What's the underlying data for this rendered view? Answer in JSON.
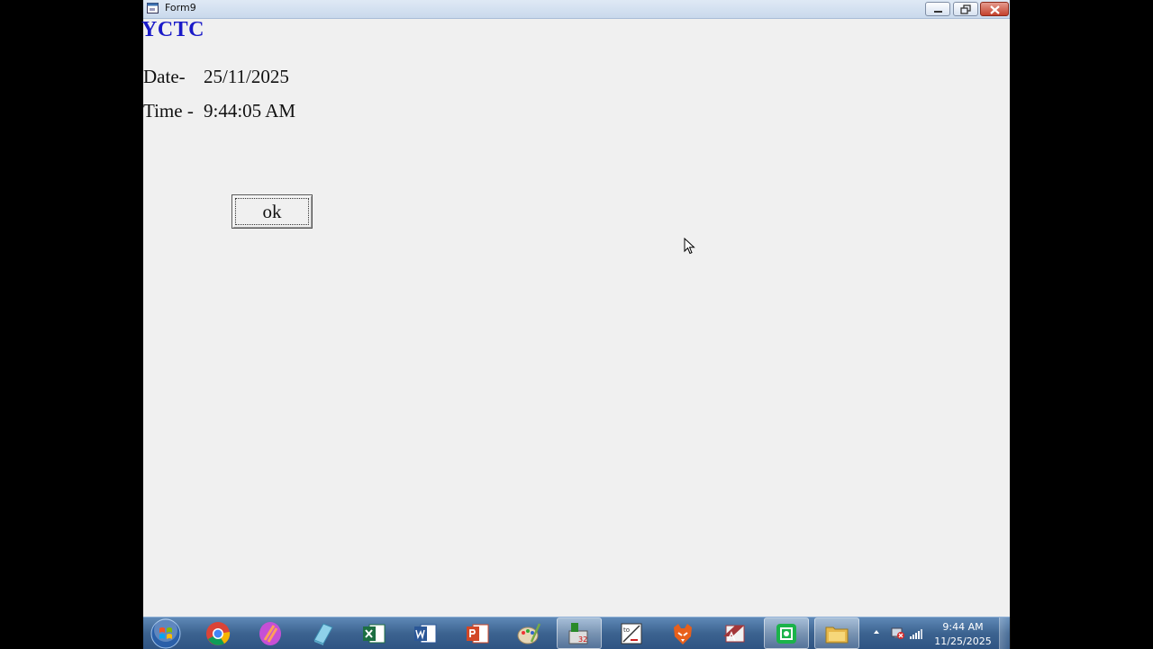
{
  "window": {
    "title": "Form9"
  },
  "form": {
    "heading": "YCTC",
    "heading_color": "#1a1ac8",
    "date_label": "Date-",
    "date_value": "25/11/2025",
    "time_label": "Time -",
    "time_value": "9:44:05 AM",
    "ok_label": "ok"
  },
  "taskbar": {
    "icons": [
      "windows-start-icon",
      "chrome-icon",
      "app-icon",
      "notepad-icon",
      "excel-icon",
      "word-icon",
      "powerpoint-icon",
      "paint-icon",
      "app-icon",
      "app-icon",
      "firefox-icon",
      "access-icon",
      "app-icon",
      "file-explorer-icon"
    ],
    "clock_time": "9:44 AM",
    "clock_date": "11/25/2025"
  }
}
